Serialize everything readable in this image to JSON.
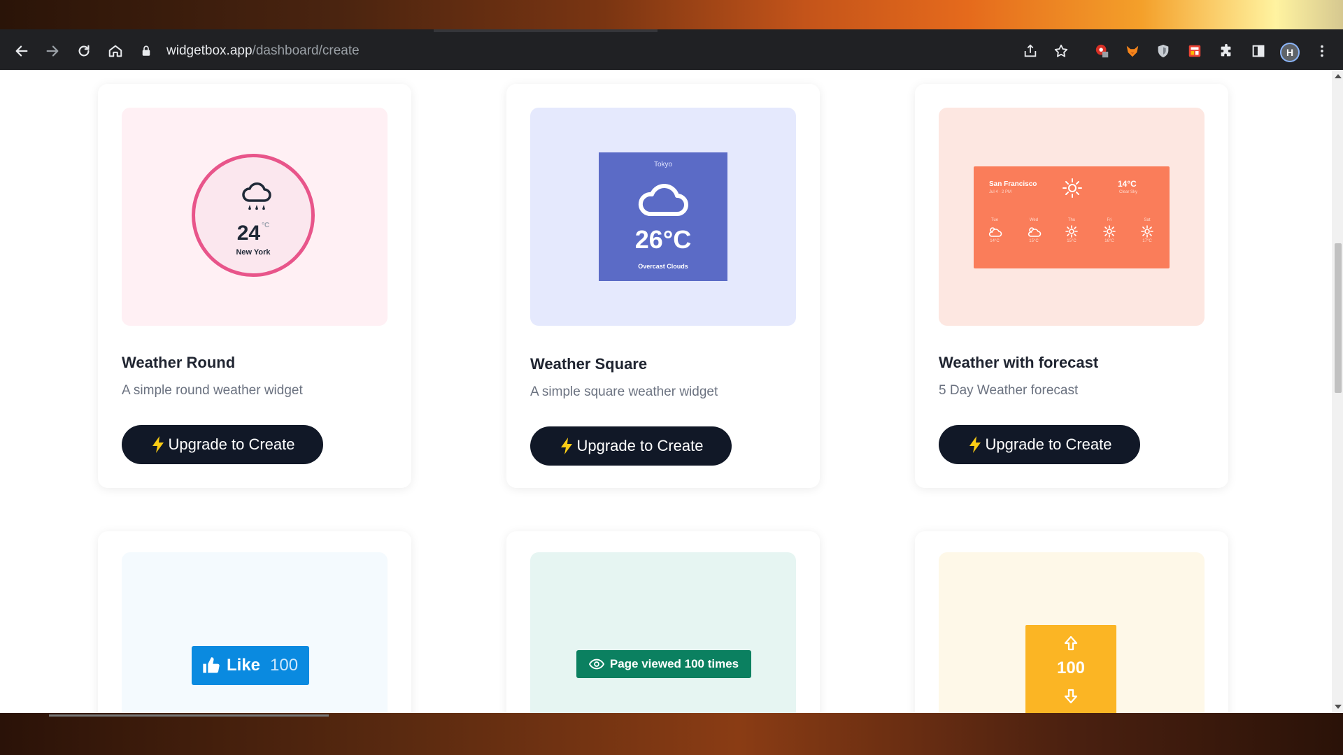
{
  "browser": {
    "url_host": "widgetbox.app",
    "url_path": "/dashboard/create",
    "profile_initial": "H"
  },
  "widgets": [
    {
      "title": "Weather Round",
      "description": "A simple round weather widget",
      "cta_label": "Upgrade to Create",
      "preview": {
        "temperature": "24",
        "unit": "°C",
        "city": "New York",
        "icon": "cloud-rain-icon"
      }
    },
    {
      "title": "Weather Square",
      "description": "A simple square weather widget",
      "cta_label": "Upgrade to Create",
      "preview": {
        "city": "Tokyo",
        "temperature": "26°C",
        "condition": "Overcast Clouds",
        "icon": "cloud-icon"
      }
    },
    {
      "title": "Weather with forecast",
      "description": "5 Day Weather forecast",
      "cta_label": "Upgrade to Create",
      "preview": {
        "city": "San Francisco",
        "subtitle": "Jul 4 · 2 PM",
        "temperature": "14°C",
        "condition": "Clear Sky",
        "days": [
          {
            "day": "Tue",
            "temp": "14°C",
            "icon": "cloudy-icon"
          },
          {
            "day": "Wed",
            "temp": "15°C",
            "icon": "cloudy-icon"
          },
          {
            "day": "Thu",
            "temp": "15°C",
            "icon": "sun-icon"
          },
          {
            "day": "Fri",
            "temp": "16°C",
            "icon": "sun-icon"
          },
          {
            "day": "Sat",
            "temp": "17°C",
            "icon": "sun-icon"
          }
        ]
      }
    },
    {
      "preview": {
        "label": "Like",
        "count": "100",
        "icon": "thumbs-up-icon"
      }
    },
    {
      "preview": {
        "label": "Page viewed 100 times",
        "icon": "eye-icon"
      }
    },
    {
      "preview": {
        "count": "100",
        "icon_up": "arrow-up-icon",
        "icon_down": "arrow-down-icon"
      }
    }
  ],
  "colors": {
    "cta_bg": "#111827",
    "round_bg": "#fff0f4",
    "square_bg": "#e5e9fd",
    "forecast_bg": "#fde7e1",
    "like_bg": "#f4fafe",
    "views_bg": "#e6f5f2",
    "vote_bg": "#fef8e8",
    "like_button": "#0a8ae0",
    "views_badge": "#0b8060",
    "vote_box": "#fbb524"
  }
}
